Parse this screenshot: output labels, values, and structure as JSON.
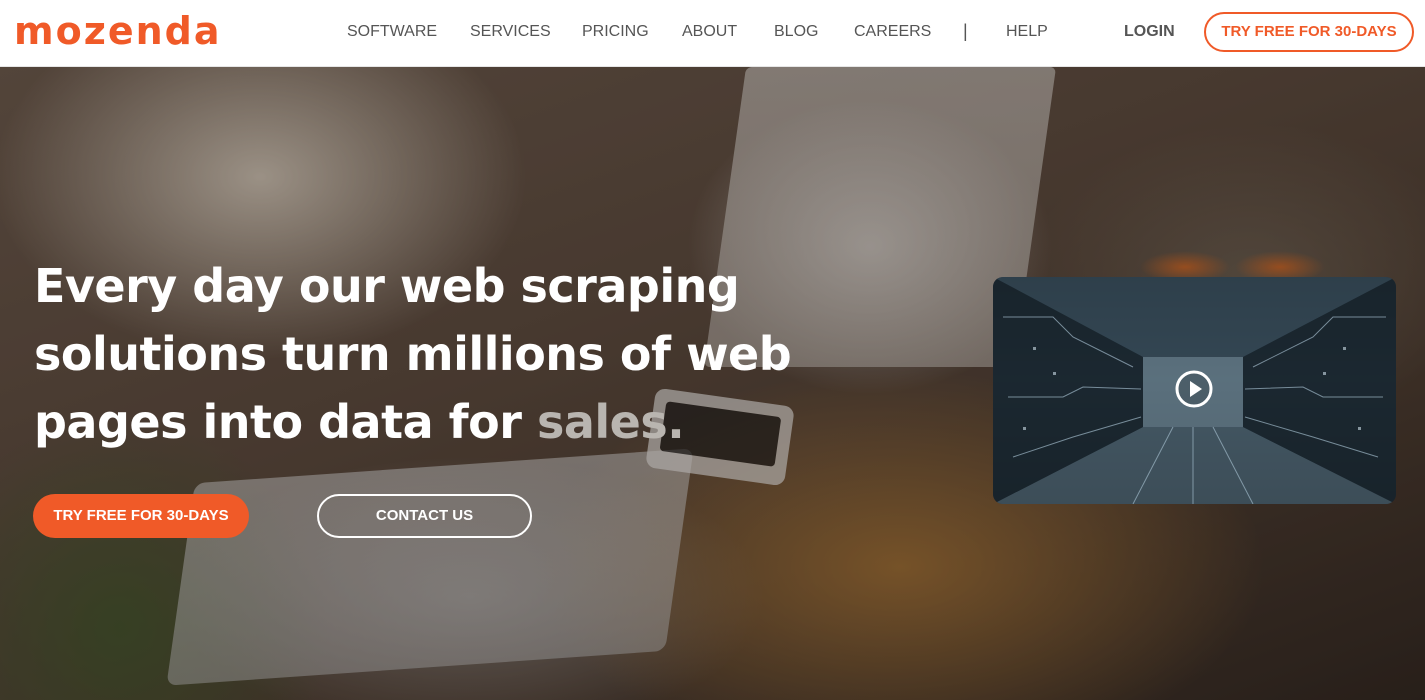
{
  "brand": {
    "logo_text": "mozenda",
    "accent_color": "#f05a28"
  },
  "nav": {
    "items": [
      {
        "label": "SOFTWARE"
      },
      {
        "label": "SERVICES"
      },
      {
        "label": "PRICING"
      },
      {
        "label": "ABOUT"
      },
      {
        "label": "BLOG"
      },
      {
        "label": "CAREERS"
      },
      {
        "label": "HELP"
      }
    ],
    "separator": "|",
    "login_label": "LOGIN",
    "cta_label": "TRY FREE FOR 30-DAYS"
  },
  "hero": {
    "headline": "Every day our web scraping solutions turn millions of web pages into data for",
    "headline_accent": "sales.",
    "primary_cta": "TRY FREE FOR 30-DAYS",
    "secondary_cta": "CONTACT US"
  },
  "video": {
    "play_icon": "play-circle-icon"
  }
}
